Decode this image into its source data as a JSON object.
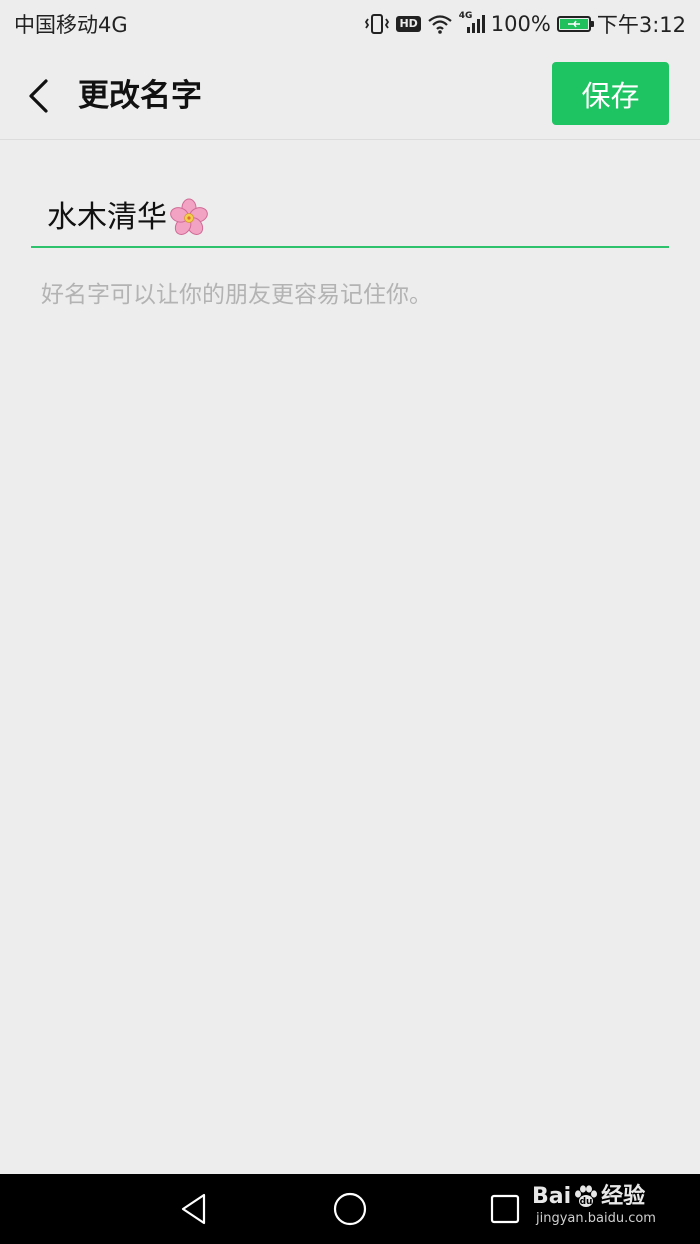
{
  "status_bar": {
    "carrier": "中国移动4G",
    "hd_label": "HD",
    "network_label": "4G",
    "battery_percent": "100%",
    "time": "下午3:12",
    "battery_level": 1.0
  },
  "header": {
    "title": "更改名字",
    "save_label": "保存"
  },
  "form": {
    "name_value": "水木清华",
    "name_emoji": "cherry-blossom",
    "hint": "好名字可以让你的朋友更容易记住你。"
  },
  "watermark": {
    "brand_left": "Bai",
    "brand_right": "经验",
    "url": "jingyan.baidu.com"
  },
  "colors": {
    "accent": "#1ec461",
    "underline": "#2fc26c",
    "background": "#ededed",
    "hint": "#b3b3b3"
  }
}
